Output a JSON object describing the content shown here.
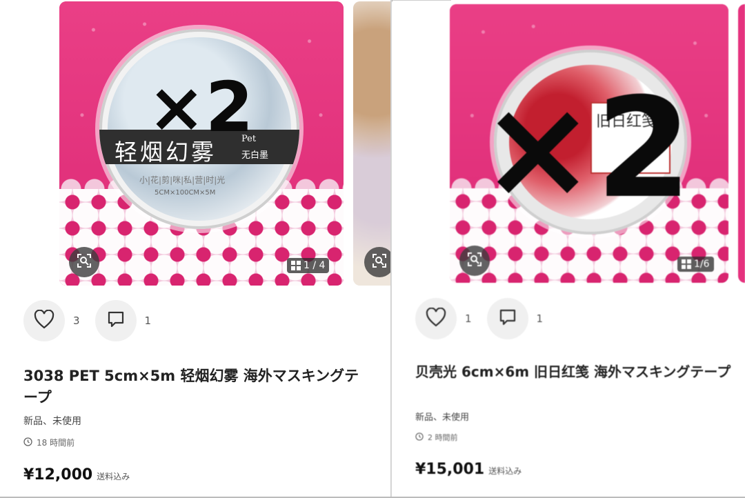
{
  "left_listing": {
    "image": {
      "tape_title": "轻烟幻雾",
      "tape_subtitle_top": "Pet",
      "tape_subtitle_bottom": "无白墨",
      "tape_tagline": "小|花|剪|咪|私|营|时|光",
      "tape_size": "5CM×100CM×5M",
      "overlay_text": "×2",
      "counter": "1 / 4"
    },
    "likes": "3",
    "comments": "1",
    "title": "3038 PET 5cm×5m 轻烟幻雾 海外マスキングテープ",
    "condition": "新品、未使用",
    "time_ago": "18 時間前",
    "price": "¥12,000",
    "shipping": "送料込み"
  },
  "right_listing": {
    "image": {
      "tape_title": "旧日红笺",
      "overlay_text": "×2",
      "counter": "1/6"
    },
    "likes": "1",
    "comments": "1",
    "title": "贝壳光 6cm×6m 旧日红笺 海外マスキングテープ",
    "condition": "新品、未使用",
    "time_ago": "2 時間前",
    "price": "¥15,001",
    "shipping": "送料込み"
  },
  "colors": {
    "pink_background": "#e5327e",
    "lace": "#f3c7dc",
    "overlay_text": "#0a0a0a"
  },
  "icons": [
    "lens-search-icon",
    "grid-gallery-icon",
    "heart-icon",
    "comment-icon",
    "clock-icon"
  ]
}
